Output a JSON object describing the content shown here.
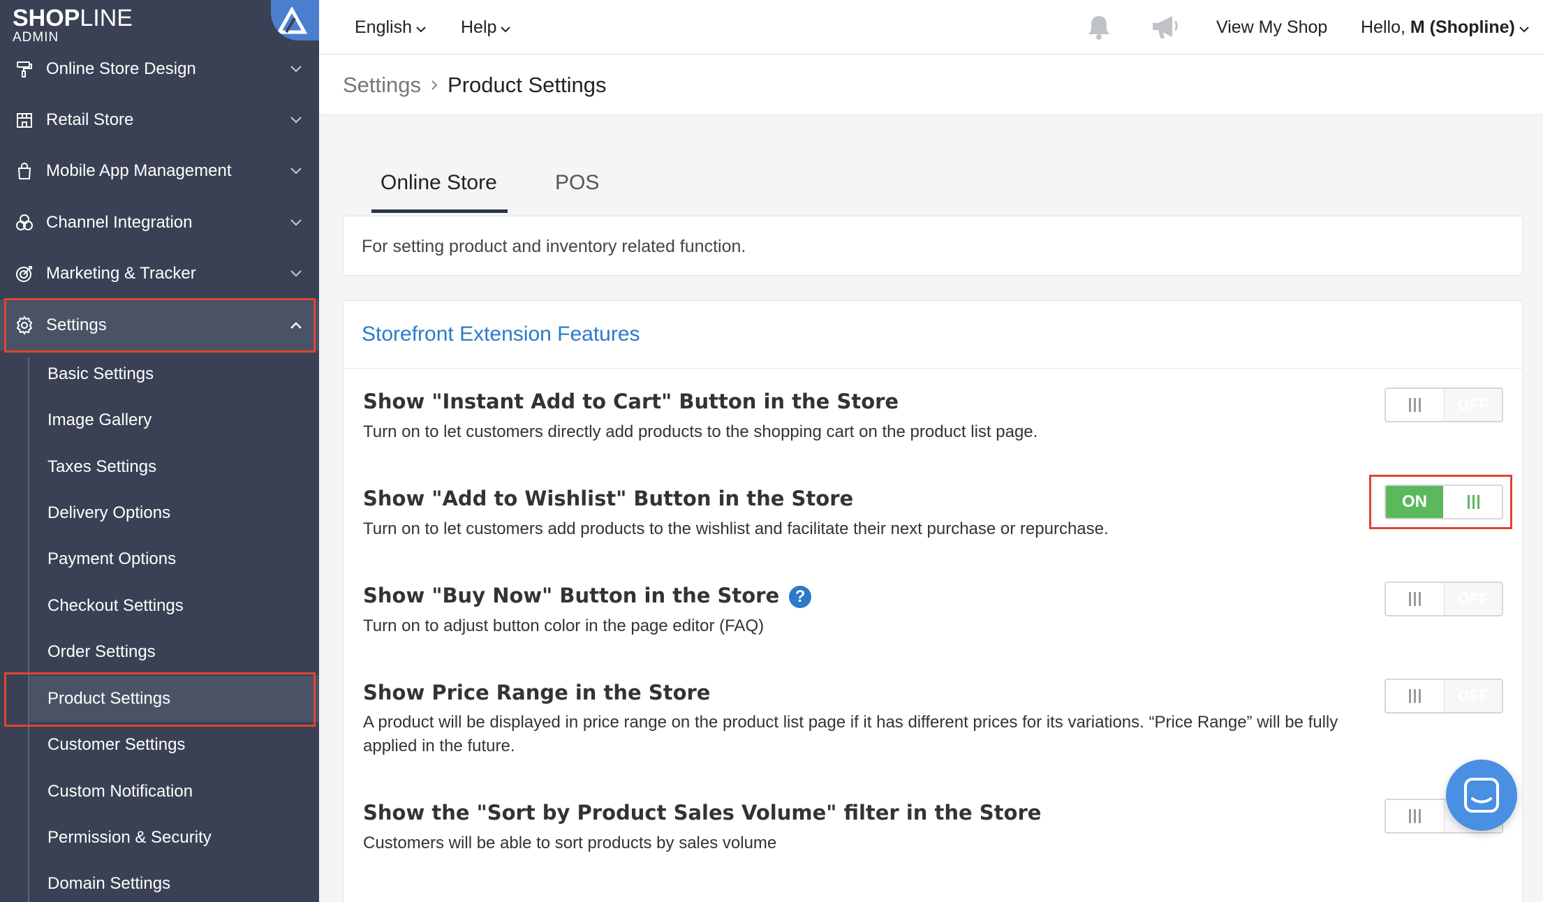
{
  "logo": {
    "brand_bold": "SHOP",
    "brand_thin": "LINE",
    "sub": "ADMIN"
  },
  "sidebar": {
    "items": [
      {
        "label": "Online Store Design",
        "icon": "paint-roller-icon"
      },
      {
        "label": "Retail Store",
        "icon": "store-icon"
      },
      {
        "label": "Mobile App Management",
        "icon": "shopping-bag-icon"
      },
      {
        "label": "Channel Integration",
        "icon": "circles-icon"
      },
      {
        "label": "Marketing & Tracker",
        "icon": "target-icon"
      },
      {
        "label": "Settings",
        "icon": "gear-icon"
      }
    ],
    "subitems": [
      "Basic Settings",
      "Image Gallery",
      "Taxes Settings",
      "Delivery Options",
      "Payment Options",
      "Checkout Settings",
      "Order Settings",
      "Product Settings",
      "Customer Settings",
      "Custom Notification",
      "Permission & Security",
      "Domain Settings"
    ]
  },
  "topbar": {
    "language": "English",
    "help": "Help",
    "view_shop": "View My Shop",
    "greeting": "Hello, ",
    "user": "M (Shopline)"
  },
  "breadcrumb": {
    "root": "Settings",
    "current": "Product Settings"
  },
  "tabs": [
    "Online Store",
    "POS"
  ],
  "description": "For setting product and inventory related function.",
  "section": {
    "title": "Storefront Extension Features",
    "rows": [
      {
        "title": "Show \"Instant Add to Cart\" Button in the Store",
        "desc": "Turn on to let customers directly add products to the shopping cart on the product list page.",
        "state": "OFF"
      },
      {
        "title": "Show \"Add to Wishlist\" Button in the Store",
        "desc": "Turn on to let customers add products to the wishlist and facilitate their next purchase or repurchase.",
        "state": "ON"
      },
      {
        "title": "Show \"Buy Now\" Button in the Store",
        "desc": "Turn on to adjust button color in the page editor (FAQ)",
        "state": "OFF"
      },
      {
        "title": "Show Price Range in the Store",
        "desc": "A product will be displayed in price range on the product list page if it has different prices for its variations. “Price Range” will be fully applied in the future.",
        "state": "OFF"
      },
      {
        "title": "Show the \"Sort by Product Sales Volume\" filter in the Store",
        "desc": "Customers will be able to sort products by sales volume",
        "state": "OFF"
      }
    ]
  },
  "help_glyph": "?",
  "colors": {
    "sidebar": "#3a4154",
    "accent": "#2c7ac9",
    "on": "#5cb85c",
    "highlight": "#e0452e"
  }
}
